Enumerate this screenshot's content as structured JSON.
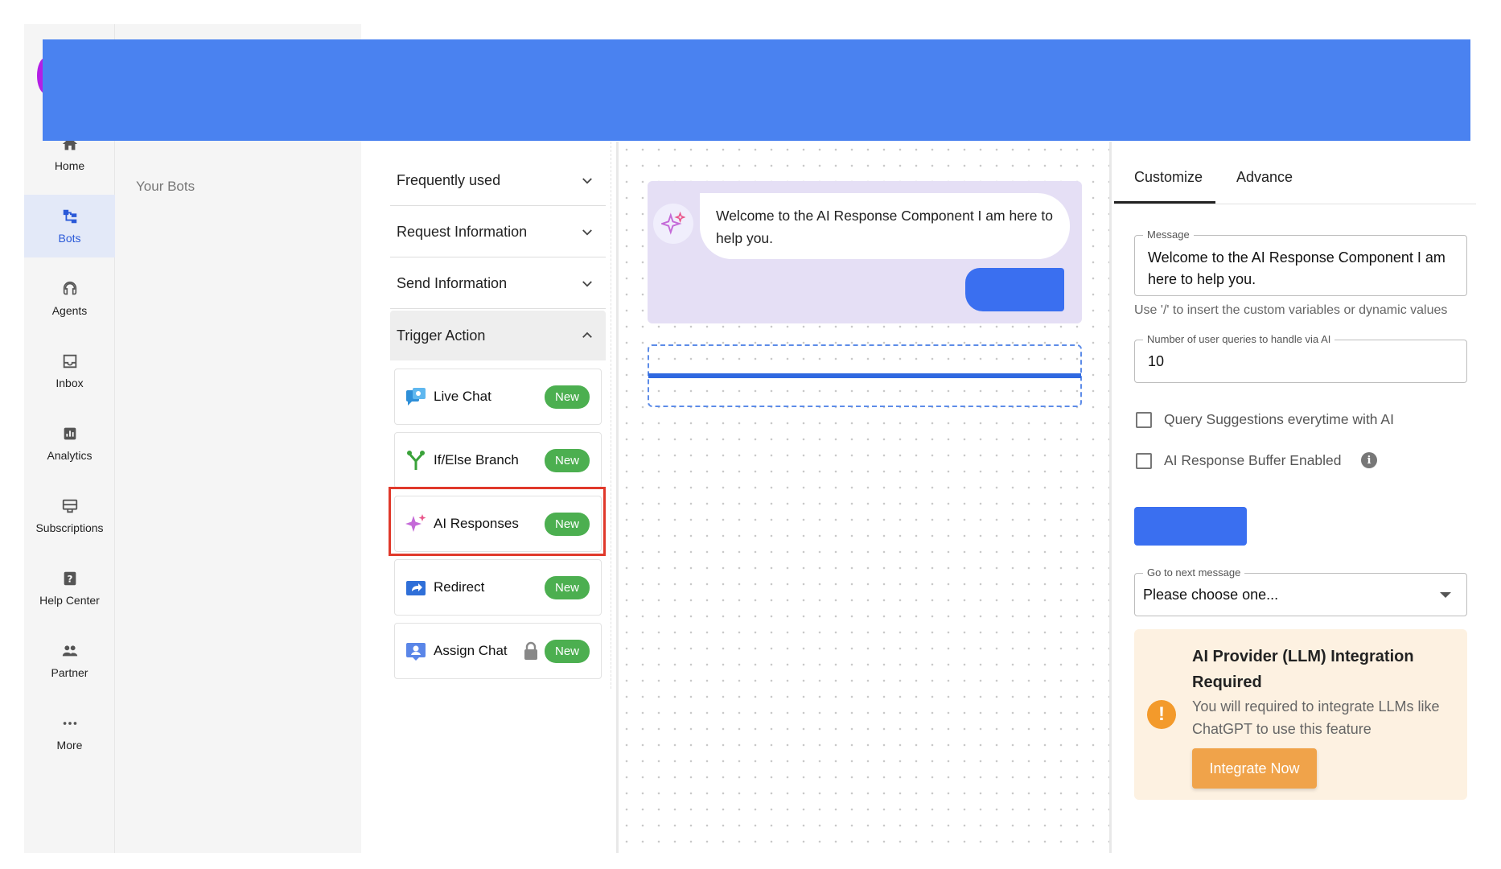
{
  "nav": {
    "items": [
      {
        "label": "Home",
        "icon": "home-icon"
      },
      {
        "label": "Bots",
        "icon": "bots-icon",
        "active": true
      },
      {
        "label": "Agents",
        "icon": "headset-icon"
      },
      {
        "label": "Inbox",
        "icon": "inbox-icon"
      },
      {
        "label": "Analytics",
        "icon": "analytics-icon"
      },
      {
        "label": "Subscriptions",
        "icon": "subscriptions-icon"
      },
      {
        "label": "Help Center",
        "icon": "help-icon"
      },
      {
        "label": "Partner",
        "icon": "people-icon"
      },
      {
        "label": "More",
        "icon": "more-icon"
      }
    ]
  },
  "secondary": {
    "your_bots": "Your Bots"
  },
  "palette": {
    "sections": [
      {
        "label": "Frequently used",
        "expanded": false
      },
      {
        "label": "Request Information",
        "expanded": false
      },
      {
        "label": "Send Information",
        "expanded": false
      },
      {
        "label": "Trigger Action",
        "expanded": true
      }
    ],
    "tools": [
      {
        "label": "Live Chat",
        "badge": "New",
        "icon": "live-chat-icon"
      },
      {
        "label": "If/Else Branch",
        "badge": "New",
        "icon": "branch-icon"
      },
      {
        "label": "AI Responses",
        "badge": "New",
        "icon": "sparkle-icon",
        "highlighted": true
      },
      {
        "label": "Redirect",
        "badge": "New",
        "icon": "redirect-icon"
      },
      {
        "label": "Assign Chat",
        "badge": "New",
        "icon": "assign-chat-icon",
        "locked": true
      }
    ]
  },
  "canvas": {
    "message": "Welcome to the AI Response Component I am here to help you."
  },
  "right": {
    "tabs": [
      "Customize",
      "Advance"
    ],
    "active_tab": "Customize",
    "message_field": {
      "label": "Message",
      "value": "Welcome to the AI Response Component I am here to help you."
    },
    "hint": "Use '/' to insert the custom variables or dynamic values",
    "queries_field": {
      "label": "Number of user queries to handle via AI",
      "value": "10"
    },
    "checkbox_query_suggestions": {
      "label": "Query Suggestions everytime with AI",
      "checked": false
    },
    "checkbox_buffer": {
      "label": "AI Response Buffer Enabled",
      "checked": false
    },
    "next_message": {
      "label": "Go to next message",
      "value": "Please choose one..."
    },
    "llm_notice": {
      "title": "AI Provider (LLM) Integration Required",
      "description": "You will required to integrate LLMs like ChatGPT to use this feature",
      "button": "Integrate Now"
    }
  },
  "colors": {
    "accent": "#3a6ff0",
    "badge": "#4caf50",
    "highlight": "#e0392b",
    "notice_bg": "#fdf1e1",
    "notice_button": "#f0a34a"
  }
}
